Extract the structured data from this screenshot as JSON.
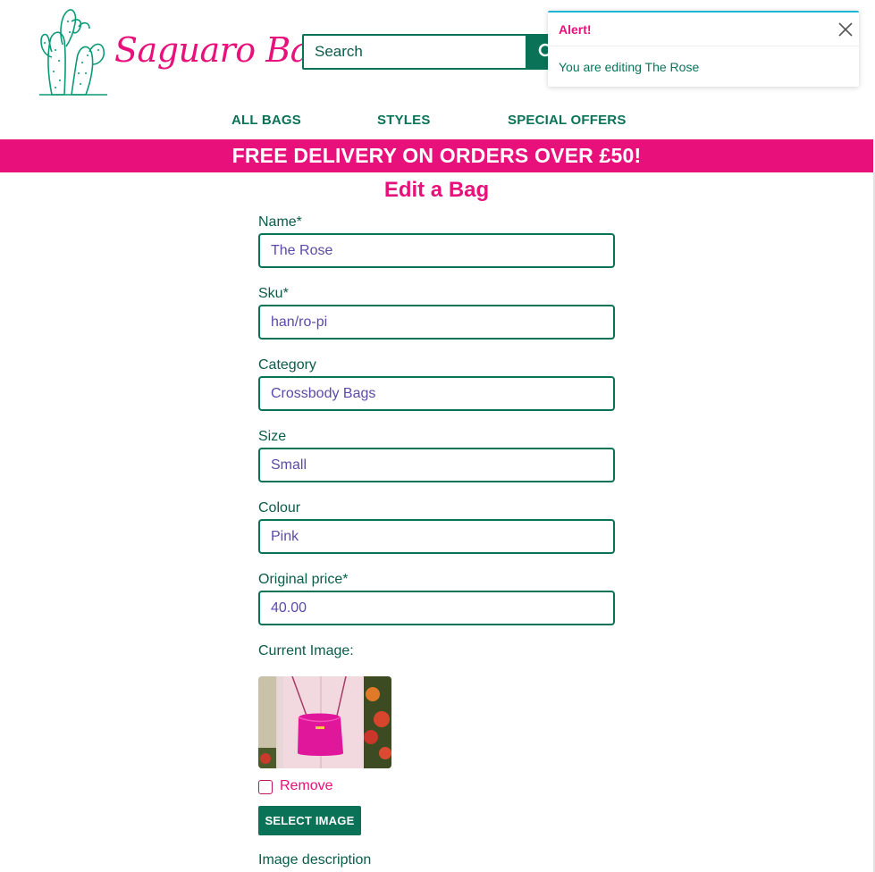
{
  "brand": {
    "name": "Saguaro Bags",
    "pink": "#e8107a",
    "green": "#0a7357"
  },
  "header": {
    "search_placeholder": "Search",
    "search_icon": "search-icon"
  },
  "nav": {
    "items": [
      {
        "label": "ALL BAGS"
      },
      {
        "label": "STYLES"
      },
      {
        "label": "SPECIAL OFFERS"
      }
    ]
  },
  "banner": {
    "text": "FREE DELIVERY ON ORDERS OVER £50!"
  },
  "page": {
    "title": "Edit a Bag"
  },
  "form": {
    "fields": [
      {
        "label": "Name*",
        "value": "The Rose"
      },
      {
        "label": "Sku*",
        "value": "han/ro-pi"
      },
      {
        "label": "Category",
        "value": "Crossbody Bags"
      },
      {
        "label": "Size",
        "value": "Small"
      },
      {
        "label": "Colour",
        "value": "Pink"
      },
      {
        "label": "Original price*",
        "value": "40.00"
      }
    ],
    "current_image_label": "Current Image:",
    "remove_label": "Remove",
    "select_image_label": "SELECT IMAGE",
    "image_description_label": "Image description"
  },
  "toast": {
    "title": "Alert!",
    "message": "You are editing The Rose",
    "close_icon": "close-icon",
    "accent": "#1fb6d6"
  }
}
